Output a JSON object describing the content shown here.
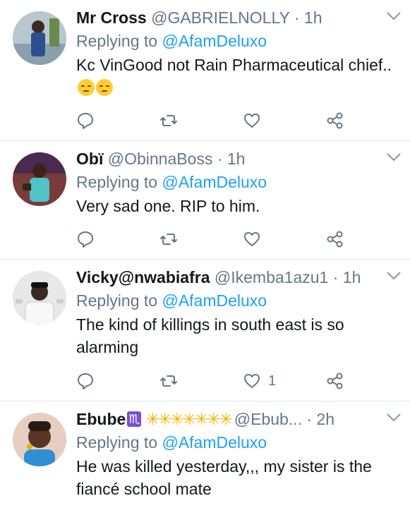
{
  "tweets": [
    {
      "name": "Mr Cross",
      "handle": "@GABRIELNOLLY",
      "time": "1h",
      "reply_prefix": "Replying to",
      "reply_to": "@AfamDeluxo",
      "text": "Kc VinGood not Rain Pharmaceutical chief..",
      "emojis": [
        "pensive-face",
        "pensive-face"
      ],
      "likes": ""
    },
    {
      "name": "Obï",
      "handle": "@ObinnaBoss",
      "time": "1h",
      "reply_prefix": "Replying to",
      "reply_to": "@AfamDeluxo",
      "text": "Very sad one. RIP to him.",
      "likes": ""
    },
    {
      "name": "Vicky@nwabiafra",
      "handle": "@Ikemba1azu1",
      "time": "1h",
      "reply_prefix": "Replying to",
      "reply_to": "@AfamDeluxo",
      "text": "The kind of killings in south east is so alarming",
      "likes": "1"
    },
    {
      "name": "Ebube",
      "name_badge": "♏",
      "name_stars": "✳✳✳✳✳✳✳",
      "handle": "@Ebub...",
      "time": "2h",
      "reply_prefix": "Replying to",
      "reply_to": "@AfamDeluxo",
      "text": "He was killed yesterday,,, my sister is the fiancé  school mate"
    }
  ],
  "separator": "·",
  "colors": {
    "accent": "#1da1f2",
    "muted": "#657786",
    "text": "#14171a",
    "divider": "#e1e8ed"
  },
  "icons": [
    "reply-icon",
    "retweet-icon",
    "like-icon",
    "share-icon",
    "chevron-down-icon"
  ]
}
